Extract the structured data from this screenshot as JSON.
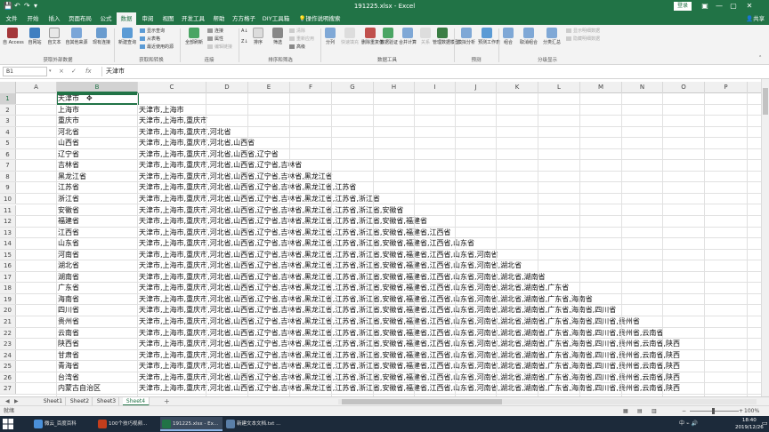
{
  "titlebar": {
    "title": "191225.xlsx - Excel",
    "login": "登录",
    "save_icon": "save-icon",
    "undo_icon": "undo-icon",
    "redo_icon": "redo-icon",
    "min": "—",
    "max": "▢",
    "close": "✕"
  },
  "tabs": [
    {
      "label": "文件",
      "active": false
    },
    {
      "label": "开始",
      "active": false
    },
    {
      "label": "插入",
      "active": false
    },
    {
      "label": "页面布局",
      "active": false
    },
    {
      "label": "公式",
      "active": false
    },
    {
      "label": "数据",
      "active": true
    },
    {
      "label": "审阅",
      "active": false
    },
    {
      "label": "视图",
      "active": false
    },
    {
      "label": "开发工具",
      "active": false
    },
    {
      "label": "帮助",
      "active": false
    },
    {
      "label": "方方格子",
      "active": false
    },
    {
      "label": "DIY工具箱",
      "active": false
    },
    {
      "label": "操作说明搜索",
      "active": false
    }
  ],
  "share": "共享",
  "ribbon": {
    "get_external": {
      "group": "获取外部数据",
      "buttons": [
        "自 Access",
        "自网站",
        "自文本",
        "自其他来源",
        "现有连接"
      ]
    },
    "get_transform": {
      "group": "获取和转换",
      "new_query": "新建查询",
      "small": [
        "显示查询",
        "从表格",
        "最近使用的源"
      ]
    },
    "connections": {
      "group": "连接",
      "refresh_all": "全部刷新",
      "small": [
        "连接",
        "属性",
        "编辑链接"
      ]
    },
    "sort_filter": {
      "group": "排序和筛选",
      "sort": "排序",
      "filter": "筛选",
      "small": [
        "清除",
        "重新应用",
        "高级"
      ]
    },
    "data_tools": {
      "group": "数据工具",
      "buttons": [
        "分列",
        "快速填充",
        "删除重复值",
        "数据验证",
        "合并计算",
        "关系",
        "管理数据模型"
      ]
    },
    "forecast": {
      "group": "预测",
      "buttons": [
        "模拟分析",
        "预测工作表"
      ]
    },
    "outline": {
      "group": "分级显示",
      "buttons": [
        "组合",
        "取消组合",
        "分类汇总"
      ],
      "small": [
        "显示明细数据",
        "隐藏明细数据"
      ]
    }
  },
  "formula_bar": {
    "name_box": "B1",
    "cancel": "×",
    "enter": "✓",
    "fx": "fx",
    "value": "天津市"
  },
  "columns": [
    "A",
    "B",
    "C",
    "D",
    "E",
    "F",
    "G",
    "H",
    "I",
    "J",
    "K",
    "L",
    "M",
    "N",
    "O",
    "P"
  ],
  "selected_column": "B",
  "rows": [
    {
      "n": "1",
      "b": "天津市",
      "c": ""
    },
    {
      "n": "2",
      "b": "上海市",
      "c": "天津市,上海市"
    },
    {
      "n": "3",
      "b": "重庆市",
      "c": "天津市,上海市,重庆市"
    },
    {
      "n": "4",
      "b": "河北省",
      "c": "天津市,上海市,重庆市,河北省"
    },
    {
      "n": "5",
      "b": "山西省",
      "c": "天津市,上海市,重庆市,河北省,山西省"
    },
    {
      "n": "6",
      "b": "辽宁省",
      "c": "天津市,上海市,重庆市,河北省,山西省,辽宁省"
    },
    {
      "n": "7",
      "b": "吉林省",
      "c": "天津市,上海市,重庆市,河北省,山西省,辽宁省,吉林省"
    },
    {
      "n": "8",
      "b": "黑龙江省",
      "c": "天津市,上海市,重庆市,河北省,山西省,辽宁省,吉林省,黑龙江省"
    },
    {
      "n": "9",
      "b": "江苏省",
      "c": "天津市,上海市,重庆市,河北省,山西省,辽宁省,吉林省,黑龙江省,江苏省"
    },
    {
      "n": "10",
      "b": "浙江省",
      "c": "天津市,上海市,重庆市,河北省,山西省,辽宁省,吉林省,黑龙江省,江苏省,浙江省"
    },
    {
      "n": "11",
      "b": "安徽省",
      "c": "天津市,上海市,重庆市,河北省,山西省,辽宁省,吉林省,黑龙江省,江苏省,浙江省,安徽省"
    },
    {
      "n": "12",
      "b": "福建省",
      "c": "天津市,上海市,重庆市,河北省,山西省,辽宁省,吉林省,黑龙江省,江苏省,浙江省,安徽省,福建省"
    },
    {
      "n": "13",
      "b": "江西省",
      "c": "天津市,上海市,重庆市,河北省,山西省,辽宁省,吉林省,黑龙江省,江苏省,浙江省,安徽省,福建省,江西省"
    },
    {
      "n": "14",
      "b": "山东省",
      "c": "天津市,上海市,重庆市,河北省,山西省,辽宁省,吉林省,黑龙江省,江苏省,浙江省,安徽省,福建省,江西省,山东省"
    },
    {
      "n": "15",
      "b": "河南省",
      "c": "天津市,上海市,重庆市,河北省,山西省,辽宁省,吉林省,黑龙江省,江苏省,浙江省,安徽省,福建省,江西省,山东省,河南省"
    },
    {
      "n": "16",
      "b": "湖北省",
      "c": "天津市,上海市,重庆市,河北省,山西省,辽宁省,吉林省,黑龙江省,江苏省,浙江省,安徽省,福建省,江西省,山东省,河南省,湖北省"
    },
    {
      "n": "17",
      "b": "湖南省",
      "c": "天津市,上海市,重庆市,河北省,山西省,辽宁省,吉林省,黑龙江省,江苏省,浙江省,安徽省,福建省,江西省,山东省,河南省,湖北省,湖南省"
    },
    {
      "n": "18",
      "b": "广东省",
      "c": "天津市,上海市,重庆市,河北省,山西省,辽宁省,吉林省,黑龙江省,江苏省,浙江省,安徽省,福建省,江西省,山东省,河南省,湖北省,湖南省,广东省"
    },
    {
      "n": "19",
      "b": "海南省",
      "c": "天津市,上海市,重庆市,河北省,山西省,辽宁省,吉林省,黑龙江省,江苏省,浙江省,安徽省,福建省,江西省,山东省,河南省,湖北省,湖南省,广东省,海南省"
    },
    {
      "n": "20",
      "b": "四川省",
      "c": "天津市,上海市,重庆市,河北省,山西省,辽宁省,吉林省,黑龙江省,江苏省,浙江省,安徽省,福建省,江西省,山东省,河南省,湖北省,湖南省,广东省,海南省,四川省"
    },
    {
      "n": "21",
      "b": "贵州省",
      "c": "天津市,上海市,重庆市,河北省,山西省,辽宁省,吉林省,黑龙江省,江苏省,浙江省,安徽省,福建省,江西省,山东省,河南省,湖北省,湖南省,广东省,海南省,四川省,贵州省"
    },
    {
      "n": "22",
      "b": "云南省",
      "c": "天津市,上海市,重庆市,河北省,山西省,辽宁省,吉林省,黑龙江省,江苏省,浙江省,安徽省,福建省,江西省,山东省,河南省,湖北省,湖南省,广东省,海南省,四川省,贵州省,云南省"
    },
    {
      "n": "23",
      "b": "陕西省",
      "c": "天津市,上海市,重庆市,河北省,山西省,辽宁省,吉林省,黑龙江省,江苏省,浙江省,安徽省,福建省,江西省,山东省,河南省,湖北省,湖南省,广东省,海南省,四川省,贵州省,云南省,陕西"
    },
    {
      "n": "24",
      "b": "甘肃省",
      "c": "天津市,上海市,重庆市,河北省,山西省,辽宁省,吉林省,黑龙江省,江苏省,浙江省,安徽省,福建省,江西省,山东省,河南省,湖北省,湖南省,广东省,海南省,四川省,贵州省,云南省,陕西"
    },
    {
      "n": "25",
      "b": "青海省",
      "c": "天津市,上海市,重庆市,河北省,山西省,辽宁省,吉林省,黑龙江省,江苏省,浙江省,安徽省,福建省,江西省,山东省,河南省,湖北省,湖南省,广东省,海南省,四川省,贵州省,云南省,陕西"
    },
    {
      "n": "26",
      "b": "台湾省",
      "c": "天津市,上海市,重庆市,河北省,山西省,辽宁省,吉林省,黑龙江省,江苏省,浙江省,安徽省,福建省,江西省,山东省,河南省,湖北省,湖南省,广东省,海南省,四川省,贵州省,云南省,陕西"
    },
    {
      "n": "27",
      "b": "内蒙古自治区",
      "c": "天津市,上海市,重庆市,河北省,山西省,辽宁省,吉林省,黑龙江省,江苏省,浙江省,安徽省,福建省,江西省,山东省,河南省,湖北省,湖南省,广东省,海南省,四川省,贵州省,云南省,陕西"
    }
  ],
  "sheets": [
    {
      "label": "Sheet1",
      "active": false
    },
    {
      "label": "Sheet2",
      "active": false
    },
    {
      "label": "Sheet3",
      "active": false
    },
    {
      "label": "Sheet4",
      "active": true
    }
  ],
  "add_sheet": "+",
  "status": {
    "ready": "就绪",
    "zoom": "100%"
  },
  "taskbar": {
    "items": [
      {
        "label": "微云_百度百科",
        "color": "#4a90d9",
        "active": false
      },
      {
        "label": "100个技巧视频...",
        "color": "#c43e1c",
        "active": false
      },
      {
        "label": "191225.xlsx - Ex...",
        "color": "#217346",
        "active": true
      },
      {
        "label": "新建文本文档.txt ...",
        "color": "#5a7fa8",
        "active": false
      }
    ],
    "time": "18:40",
    "date": "2019/12/26"
  },
  "colors": {
    "excel_green": "#217346",
    "ribbon_bg": "#f3f3f3",
    "taskbar_bg": "#1c2a3a"
  }
}
